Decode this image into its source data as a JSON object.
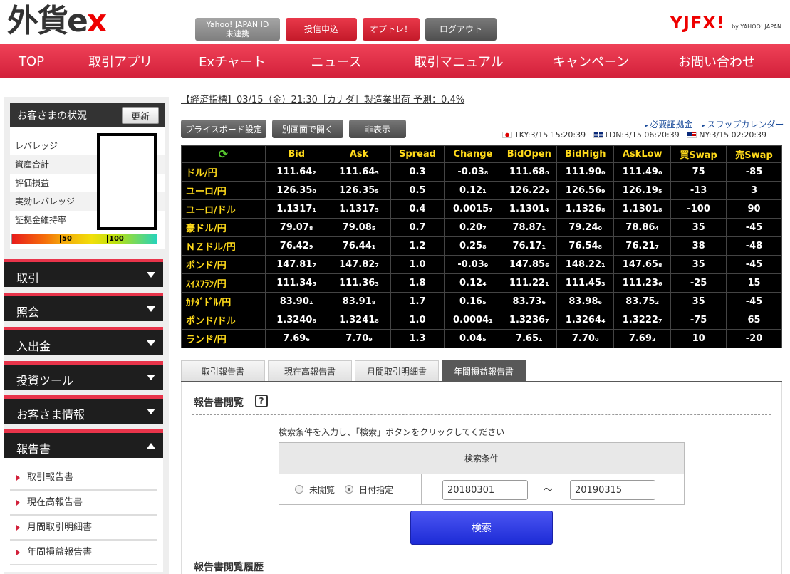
{
  "header": {
    "logo": "外貨ex",
    "yahoo_id_label": "Yahoo! JAPAN ID\n未連携",
    "toushin_label": "投信申込",
    "optre_label": "オプトレ！",
    "logout_label": "ログアウト",
    "brand_right": "YJFX!",
    "brand_right_sub": "by YAHOO! JAPAN"
  },
  "nav": {
    "items": [
      "TOP",
      "取引アプリ",
      "Exチャート",
      "ニュース",
      "取引マニュアル",
      "キャンペーン",
      "お問い合わせ"
    ]
  },
  "sidebar": {
    "status_title": "お客さまの状況",
    "refresh_label": "更新",
    "rows": [
      "レバレッジ",
      "資産合計",
      "評価損益",
      "実効レバレッジ",
      "証拠金維持率"
    ],
    "gauge_marks": [
      "50",
      "100"
    ],
    "menus": [
      "取引",
      "照会",
      "入出金",
      "投資ツール",
      "お客さま情報",
      "報告書"
    ],
    "submenu": [
      "取引報告書",
      "現在高報告書",
      "月間取引明細書",
      "年間損益報告書"
    ]
  },
  "ticker": "【経済指標】03/15（金）21:30［カナダ］製造業出荷 予測：0.4%",
  "toolbar": {
    "priceboard_label": "プライスボード設定",
    "separate_label": "別画面で開く",
    "hide_label": "非表示",
    "link_margin": "必要証拠金",
    "link_swap": "スワップカレンダー",
    "tky": "TKY:3/15 15:20:39",
    "ldn": "LDN:3/15 06:20:39",
    "ny": "NY:3/15 02:20:39"
  },
  "price_table": {
    "headers": [
      "Bid",
      "Ask",
      "Spread",
      "Change",
      "BidOpen",
      "BidHigh",
      "AskLow",
      "買Swap",
      "売Swap"
    ],
    "rows": [
      {
        "pair": "ドル/円",
        "values": [
          "111.64₂",
          "111.64₅",
          "0.3",
          "-0.03₈",
          "111.68₀",
          "111.90₀",
          "111.49₀",
          "75",
          "-85"
        ]
      },
      {
        "pair": "ユーロ/円",
        "values": [
          "126.35₀",
          "126.35₅",
          "0.5",
          "0.12₁",
          "126.22₉",
          "126.56₉",
          "126.19₅",
          "-13",
          "3"
        ]
      },
      {
        "pair": "ユーロ/ドル",
        "values": [
          "1.1317₁",
          "1.1317₅",
          "0.4",
          "0.0015₇",
          "1.1301₄",
          "1.1326₈",
          "1.1301₈",
          "-100",
          "90"
        ]
      },
      {
        "pair": "豪ドル/円",
        "values": [
          "79.07₈",
          "79.08₅",
          "0.7",
          "0.20₇",
          "78.87₁",
          "79.24₀",
          "78.86₄",
          "35",
          "-45"
        ]
      },
      {
        "pair": "ＮＺドル/円",
        "values": [
          "76.42₉",
          "76.44₁",
          "1.2",
          "0.25₈",
          "76.17₁",
          "76.54₈",
          "76.21₇",
          "38",
          "-48"
        ]
      },
      {
        "pair": "ポンド/円",
        "values": [
          "147.81₇",
          "147.82₇",
          "1.0",
          "-0.03₉",
          "147.85₆",
          "148.22₁",
          "147.65₈",
          "35",
          "-45"
        ]
      },
      {
        "pair": "ｽｲｽﾌﾗﾝ/円",
        "values": [
          "111.34₅",
          "111.36₃",
          "1.8",
          "0.12₄",
          "111.22₁",
          "111.45₃",
          "111.23₆",
          "-25",
          "15"
        ]
      },
      {
        "pair": "ｶﾅﾀﾞﾄﾞﾙ/円",
        "values": [
          "83.90₁",
          "83.91₈",
          "1.7",
          "0.16₅",
          "83.73₆",
          "83.98₆",
          "83.75₂",
          "35",
          "-45"
        ]
      },
      {
        "pair": "ポンド/ドル",
        "values": [
          "1.3240₈",
          "1.3241₈",
          "1.0",
          "0.0004₁",
          "1.3236₇",
          "1.3264₄",
          "1.3222₇",
          "-75",
          "65"
        ]
      },
      {
        "pair": "ランド/円",
        "values": [
          "7.69₆",
          "7.70₉",
          "1.3",
          "0.04₅",
          "7.65₁",
          "7.70₀",
          "7.69₂",
          "10",
          "-20"
        ]
      }
    ]
  },
  "tabs": [
    "取引報告書",
    "現在高報告書",
    "月間取引明細書",
    "年間損益報告書"
  ],
  "report": {
    "title": "報告書閲覧",
    "help_icon": "?",
    "instruction": "検索条件を入力し、「検索」ボタンをクリックしてください",
    "cond_header": "検索条件",
    "radio_unread": "未閲覧",
    "radio_date": "日付指定",
    "date_from": "20180301",
    "date_sep": "～",
    "date_to": "20190315",
    "search_label": "検索",
    "history_title": "報告書閲覧履歴"
  }
}
